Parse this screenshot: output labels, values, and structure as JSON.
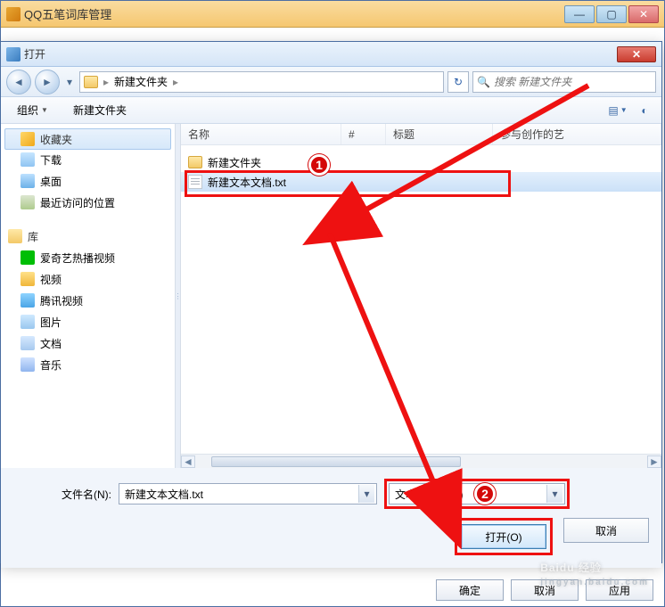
{
  "parent": {
    "title": "QQ五笔词库管理",
    "footer": {
      "ok": "确定",
      "cancel": "取消",
      "apply": "应用"
    }
  },
  "dialog": {
    "title": "打开",
    "breadcrumb": {
      "folder": "新建文件夹"
    },
    "search_placeholder": "搜索 新建文件夹",
    "toolbar": {
      "organize": "组织",
      "new_folder": "新建文件夹"
    },
    "sidebar": {
      "favorites": "收藏夹",
      "downloads": "下载",
      "desktop": "桌面",
      "recent": "最近访问的位置",
      "library": "库",
      "iqiyi": "爱奇艺热播视频",
      "video": "视频",
      "tencent_video": "腾讯视频",
      "pictures": "图片",
      "documents": "文档",
      "music": "音乐"
    },
    "columns": {
      "name": "名称",
      "num": "#",
      "title": "标题",
      "artists": "参与创作的艺"
    },
    "files": {
      "folder1": "新建文件夹",
      "file1": "新建文本文档.txt"
    },
    "filename_label": "文件名(N):",
    "filename_value": "新建文本文档.txt",
    "filetype_value": "文本文件(*.txt)",
    "open_btn": "打开(O)",
    "cancel_btn": "取消"
  },
  "annotations": {
    "step1": "1",
    "step2": "2"
  },
  "watermark": {
    "brand": "Baidu 经验",
    "url": "jingyan.baidu.com"
  }
}
